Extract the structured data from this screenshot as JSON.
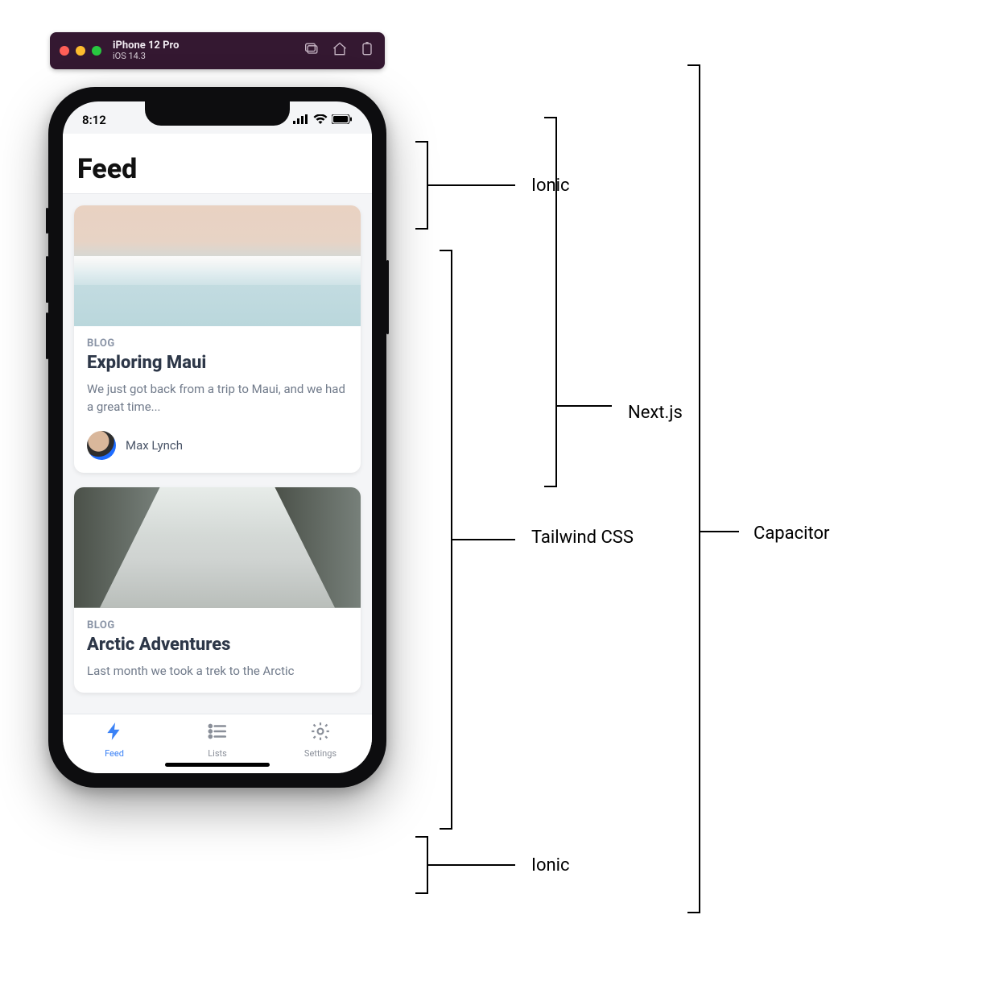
{
  "simulator": {
    "device": "iPhone 12 Pro",
    "os": "iOS 14.3"
  },
  "status": {
    "time": "8:12"
  },
  "header": {
    "title": "Feed"
  },
  "cards": [
    {
      "eyebrow": "BLOG",
      "title": "Exploring Maui",
      "excerpt": "We just got back from a trip to Maui, and we had a great time...",
      "author": "Max Lynch"
    },
    {
      "eyebrow": "BLOG",
      "title": "Arctic Adventures",
      "excerpt": "Last month we took a trek to the Arctic"
    }
  ],
  "tabs": [
    {
      "label": "Feed",
      "active": true
    },
    {
      "label": "Lists",
      "active": false
    },
    {
      "label": "Settings",
      "active": false
    }
  ],
  "annotations": {
    "ionic_top": "Ionic",
    "nextjs": "Next.js",
    "tailwind": "Tailwind CSS",
    "ionic_bottom": "Ionic",
    "capacitor": "Capacitor"
  }
}
